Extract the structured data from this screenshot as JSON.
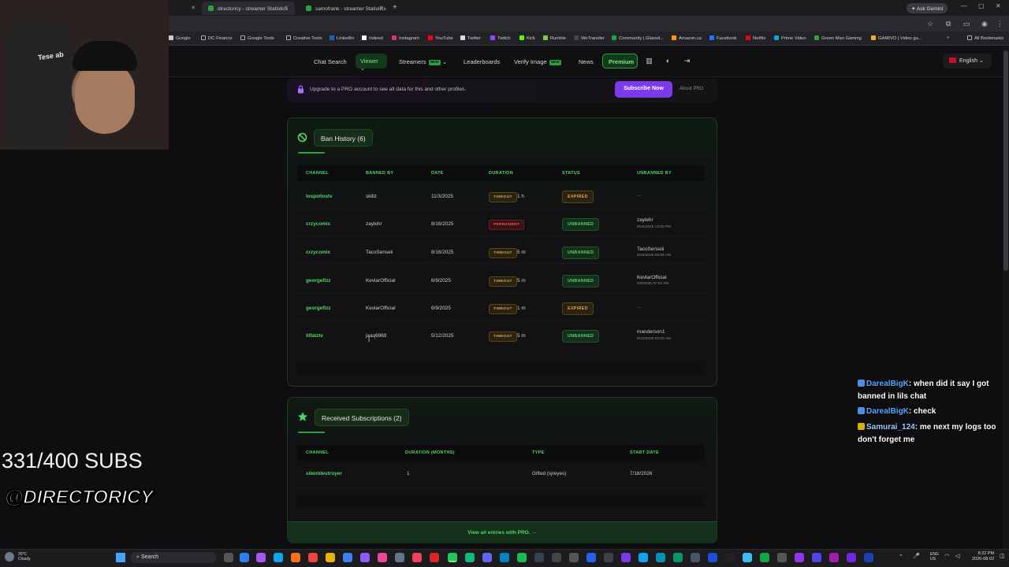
{
  "browser": {
    "tabs": [
      {
        "label": "directoricy - streamer Statistics"
      },
      {
        "label": "samofrank - streamer Statistics"
      }
    ],
    "ask_gemini": "Ask Gemini",
    "bookmarks": [
      "Google",
      "DC Finance",
      "Google Tools",
      "Creative Tools",
      "LinkedIn",
      "Indeed",
      "Instagram",
      "YouTube",
      "Twitter",
      "Twitch",
      "Kick",
      "Rumble",
      "WeTransfer",
      "Community | Glassd...",
      "Amazon.ca",
      "Facebook",
      "Netflix",
      "Prime Video",
      "Green Man Gaming",
      "GAMIVO | Video ga..."
    ],
    "all_bookmarks": "All Bookmarks"
  },
  "nav": {
    "chat_search": "Chat Search",
    "viewer": "Viewer",
    "streamers": "Streamers",
    "new_badge": "NEW",
    "leaderboards": "Leaderboards",
    "verify_image": "Verify Image",
    "news": "News",
    "premium": "Premium",
    "language": "English"
  },
  "promo": {
    "text": "Upgrade to a PRO account to see all data for this and other profiles.",
    "subscribe": "Subscribe Now",
    "about": "About PRO"
  },
  "ban_history": {
    "title": "Ban History (6)",
    "columns": [
      "CHANNEL",
      "BANNED BY",
      "DATE",
      "DURATION",
      "STATUS",
      "UNBANNED BY"
    ],
    "rows": [
      {
        "channel": "lospollostv",
        "banned_by": "skillz",
        "date": "11/3/2025",
        "type": "TIMEOUT",
        "duration": "1 h",
        "status": "EXPIRED",
        "unbanned_by": "—",
        "unbanned_at": ""
      },
      {
        "channel": "crzycomic",
        "banned_by": "zaylehr",
        "date": "8/16/2025",
        "type": "PERMANENT",
        "duration": "",
        "status": "UNBANNED",
        "unbanned_by": "zaylehr",
        "unbanned_at": "8/16/2025 13:00 PM"
      },
      {
        "channel": "crzycomic",
        "banned_by": "TacoSenseii",
        "date": "8/16/2025",
        "type": "TIMEOUT",
        "duration": "5 m",
        "status": "UNBANNED",
        "unbanned_by": "TacoSenseii",
        "unbanned_at": "8/16/2025 06:59 AM"
      },
      {
        "channel": "georgeflzz",
        "banned_by": "KevlarOfficial",
        "date": "6/9/2025",
        "type": "TIMEOUT",
        "duration": "5 m",
        "status": "UNBANNED",
        "unbanned_by": "KevlarOfficial",
        "unbanned_at": "6/9/2025 07:02 AM"
      },
      {
        "channel": "georgeflzz",
        "banned_by": "KevlarOfficial",
        "date": "6/9/2025",
        "type": "TIMEOUT",
        "duration": "1 m",
        "status": "EXPIRED",
        "unbanned_by": "—",
        "unbanned_at": ""
      },
      {
        "channel": "lilfatztv",
        "banned_by": "jaaq6969",
        "date": "5/12/2025",
        "type": "TIMEOUT",
        "duration": "5 m",
        "status": "UNBANNED",
        "unbanned_by": "manderson1",
        "unbanned_at": "5/12/2025 02:00 AM"
      }
    ]
  },
  "subscriptions": {
    "title": "Received Subscriptions (2)",
    "columns": [
      "CHANNEL",
      "DURATION (MONTHS)",
      "TYPE",
      "START DATE"
    ],
    "rows": [
      {
        "channel": "silentdestroyer",
        "duration": "1",
        "type": "Gifted (sjreyes)",
        "start": "7/18/2026"
      }
    ],
    "view_all": "View all entries with PRO. →"
  },
  "overlay": {
    "chair_text": "Tese ab",
    "subs": "331/400 SUBS",
    "handle": "@DIRECTORICY",
    "chat": [
      {
        "user": "DarealBigK",
        "msg": ": when did it say I got banned in lils chat"
      },
      {
        "user": "DarealBigK",
        "msg": ": check"
      },
      {
        "user": "Samurai_124",
        "msg": ": me next my logs too don't forget me"
      }
    ]
  },
  "taskbar": {
    "temp": "20°C",
    "weather": "Cloudy",
    "search": "Search",
    "lang1": "ENG",
    "lang2": "US",
    "time": "8:22 PM",
    "date": "2026-08-02"
  },
  "colors": {
    "accent": "#56d364",
    "purple": "#7c3aed",
    "timeout": "#d9a441",
    "permanent": "#f85149"
  }
}
